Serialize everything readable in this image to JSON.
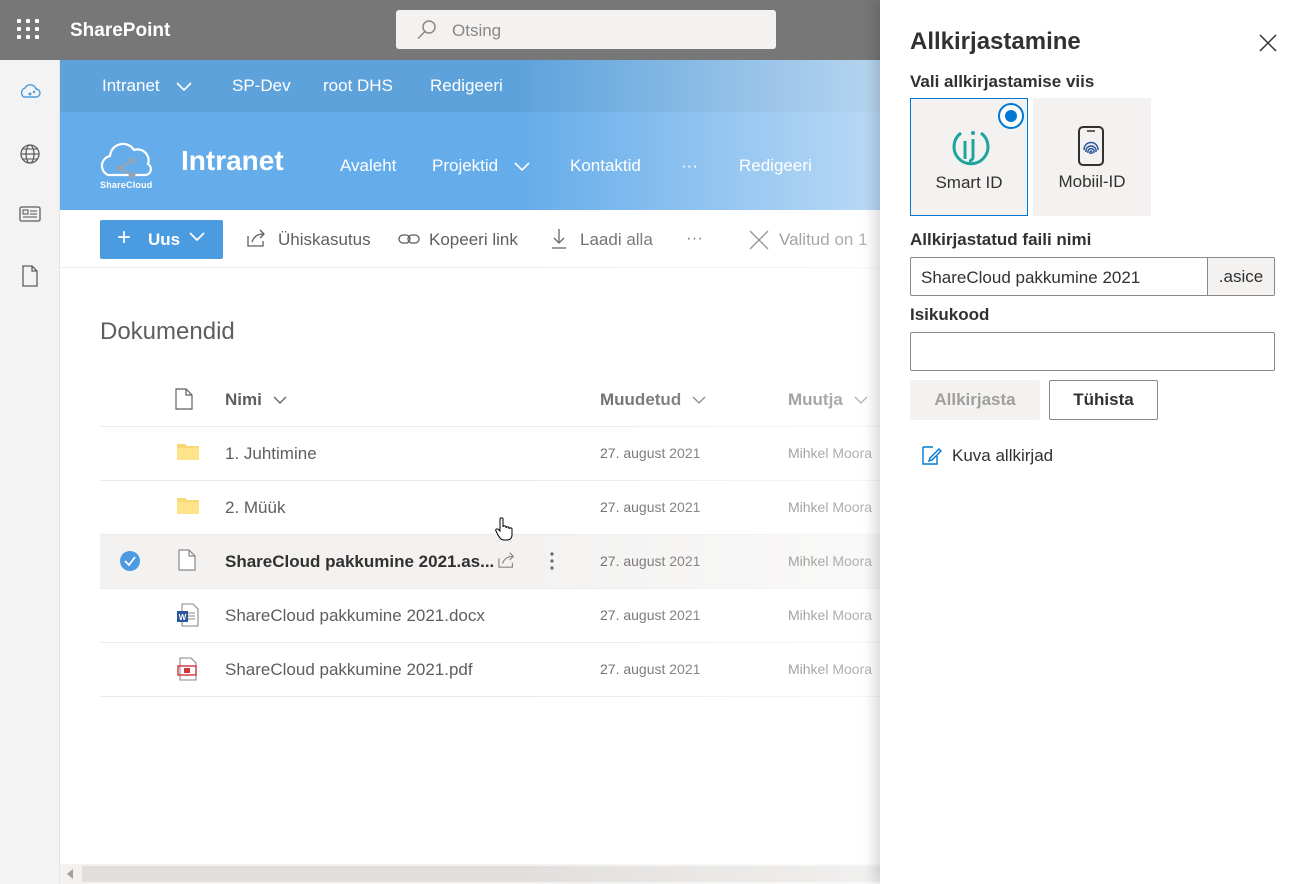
{
  "suite": {
    "brand": "SharePoint",
    "search_placeholder": "Otsing"
  },
  "hub_nav": [
    "Intranet",
    "SP-Dev",
    "root DHS",
    "Redigeeri"
  ],
  "site": {
    "logo_text": "ShareCloud",
    "title": "Intranet",
    "nav": [
      "Avaleht",
      "Projektid",
      "Kontaktid",
      "···",
      "Redigeeri"
    ]
  },
  "command_bar": {
    "new_label": "Uus",
    "share": "Ühiskasutus",
    "copy_link": "Kopeeri link",
    "download": "Laadi alla",
    "more": "···",
    "selected": "Valitud on 1"
  },
  "library": {
    "title": "Dokumendid",
    "columns": {
      "name": "Nimi",
      "modified": "Muudetud",
      "modified_by": "Muutja"
    },
    "rows": [
      {
        "name": "1. Juhtimine",
        "type": "folder",
        "modified": "27. august 2021",
        "by": "Mihkel Moora"
      },
      {
        "name": "2. Müük",
        "type": "folder",
        "modified": "27. august 2021",
        "by": "Mihkel Moora"
      },
      {
        "name": "ShareCloud pakkumine 2021.as...",
        "type": "file",
        "modified": "27. august 2021",
        "by": "Mihkel Moora",
        "selected": true
      },
      {
        "name": "ShareCloud pakkumine 2021.docx",
        "type": "word",
        "modified": "27. august 2021",
        "by": "Mihkel Moora"
      },
      {
        "name": "ShareCloud pakkumine 2021.pdf",
        "type": "pdf",
        "modified": "27. august 2021",
        "by": "Mihkel Moora"
      }
    ]
  },
  "panel": {
    "title": "Allkirjastamine",
    "method_label": "Vali allkirjastamise viis",
    "methods": [
      {
        "name": "Smart ID",
        "selected": true
      },
      {
        "name": "Mobiil-ID",
        "selected": false
      }
    ],
    "file_name_label": "Allkirjastatud faili nimi",
    "file_name_value": "ShareCloud pakkumine 2021",
    "file_suffix": ".asice",
    "id_code_label": "Isikukood",
    "id_code_value": "",
    "sign_button": "Allkirjasta",
    "cancel_button": "Tühista",
    "show_signatures": "Kuva allkirjad"
  },
  "colors": {
    "suite_bar": "#777777",
    "hub_nav": "#5ea2dc",
    "site_header": "#65acea",
    "accent": "#0078d4",
    "new_button": "#4a9be0",
    "smart_id": "#1ea59b"
  }
}
